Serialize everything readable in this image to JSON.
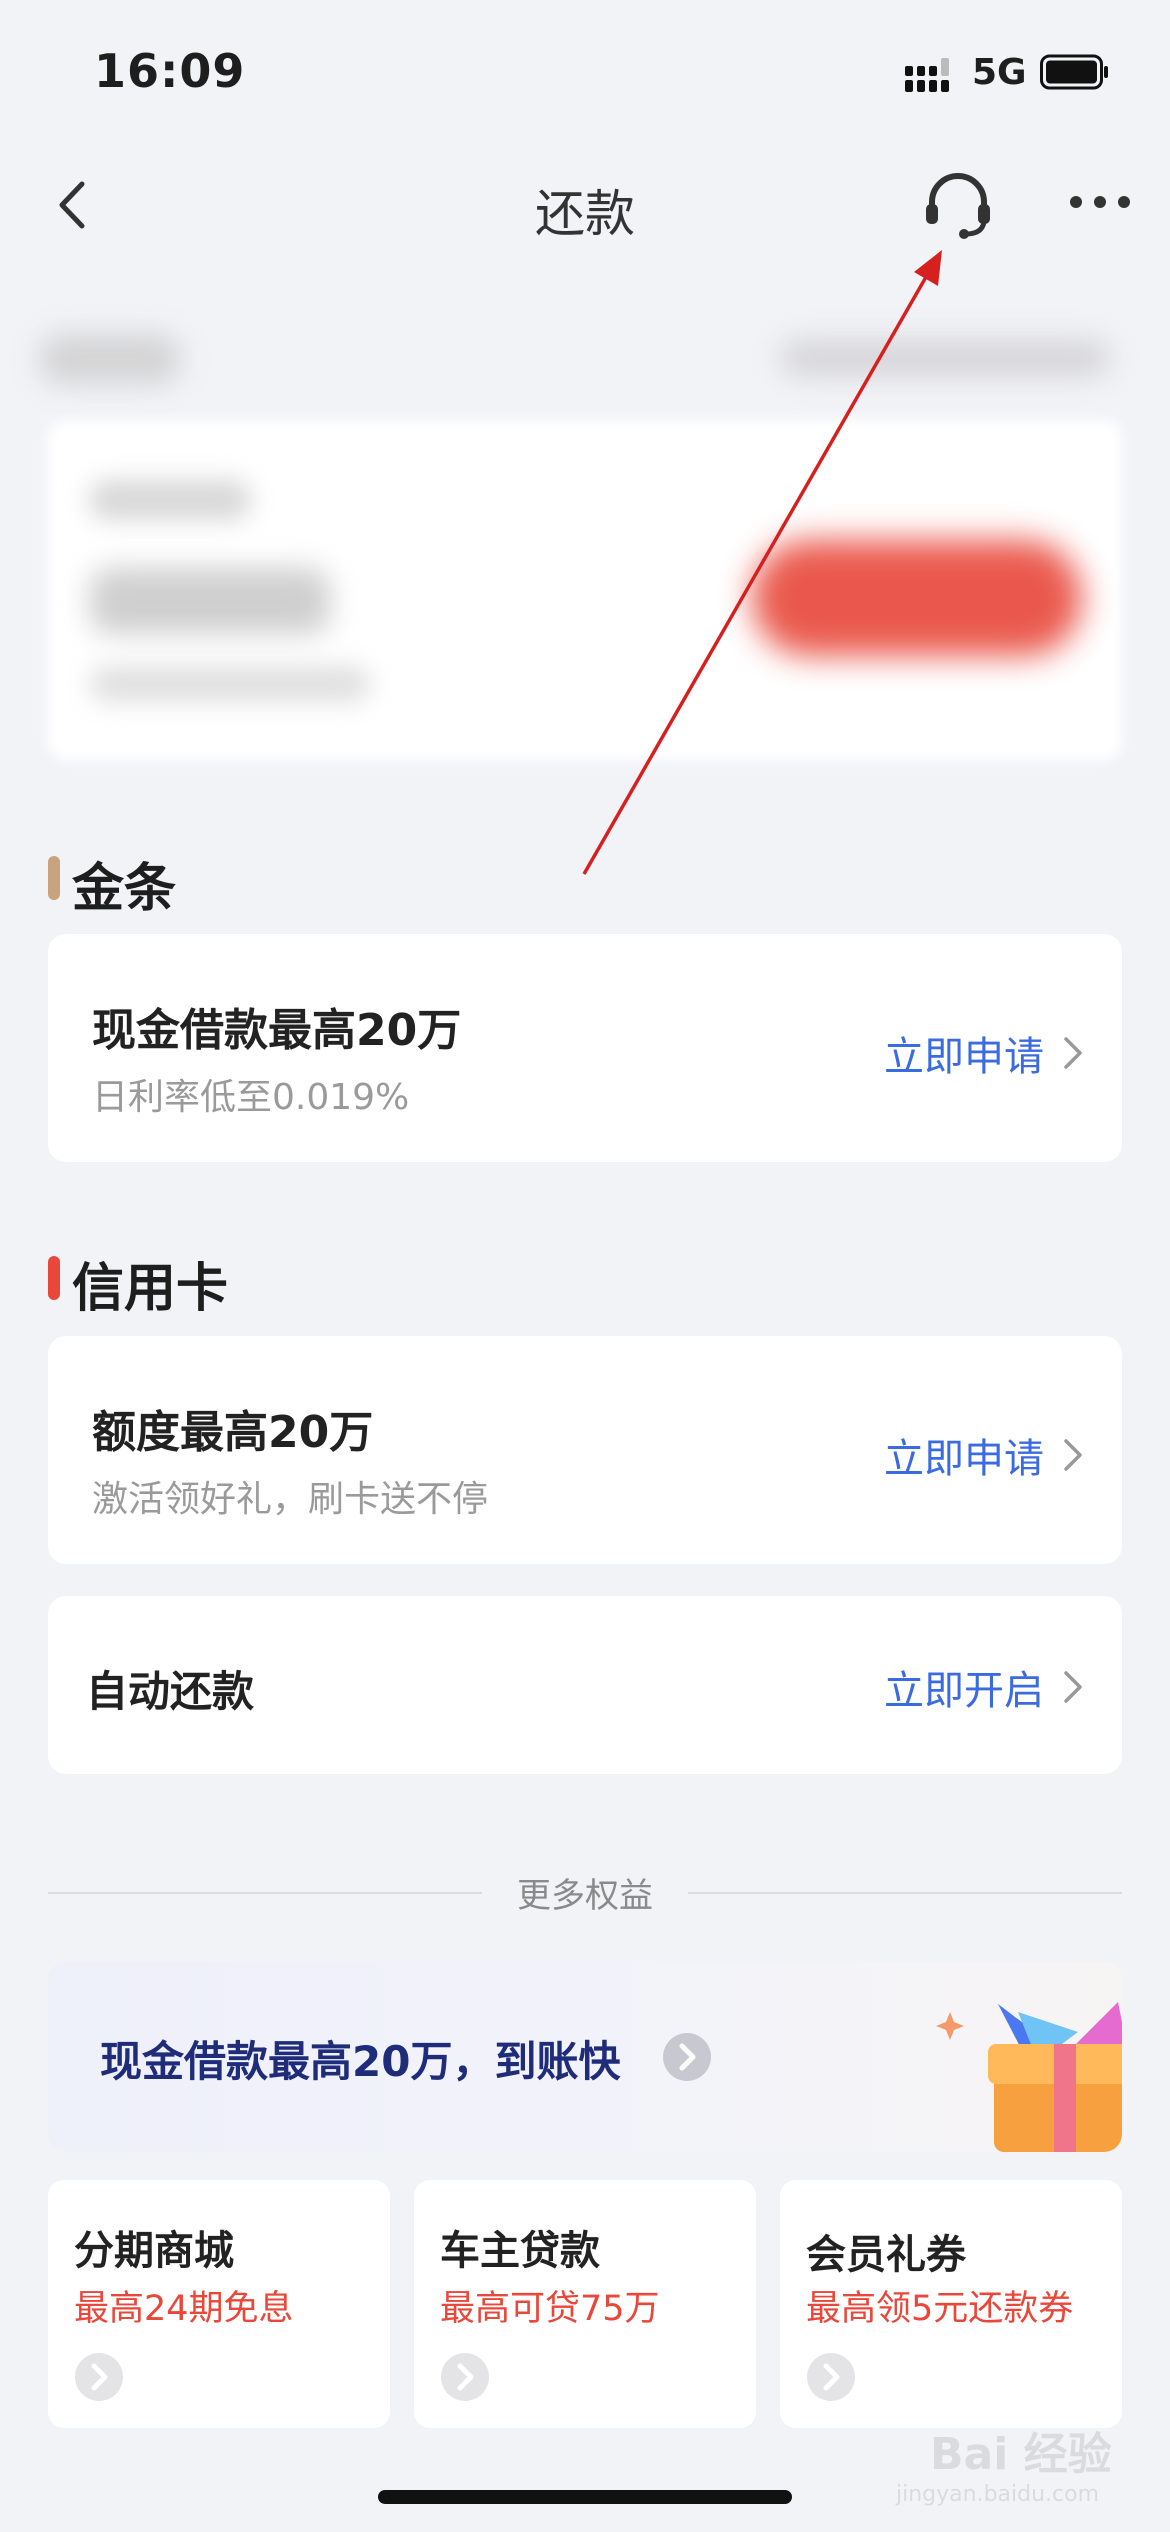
{
  "status_bar": {
    "time": "16:09",
    "network": "5G"
  },
  "nav": {
    "title": "还款"
  },
  "sections": {
    "jintiao": {
      "title": "金条",
      "bar_color": "#c9a27e",
      "card": {
        "title": "现金借款最高20万",
        "subtitle": "日利率低至0.019%",
        "action": "立即申请"
      }
    },
    "credit_card": {
      "title": "信用卡",
      "bar_color": "#e8473a",
      "card": {
        "title": "额度最高20万",
        "subtitle": "激活领好礼，刷卡送不停",
        "action": "立即申请"
      }
    },
    "auto_repay": {
      "title": "自动还款",
      "action": "立即开启"
    }
  },
  "more": {
    "divider_label": "更多权益",
    "banner": {
      "text": "现金借款最高20万，到账快"
    },
    "tiles": [
      {
        "title": "分期商城",
        "subtitle": "最高24期免息"
      },
      {
        "title": "车主贷款",
        "subtitle": "最高可贷75万"
      },
      {
        "title": "会员礼券",
        "subtitle": "最高领5元还款券"
      }
    ]
  },
  "watermark": {
    "text": "Bai 经验",
    "sub": "jingyan.baidu.com"
  },
  "colors": {
    "accent_blue": "#3b6be0",
    "accent_red": "#e8473a",
    "annotation_arrow": "#d62020"
  }
}
